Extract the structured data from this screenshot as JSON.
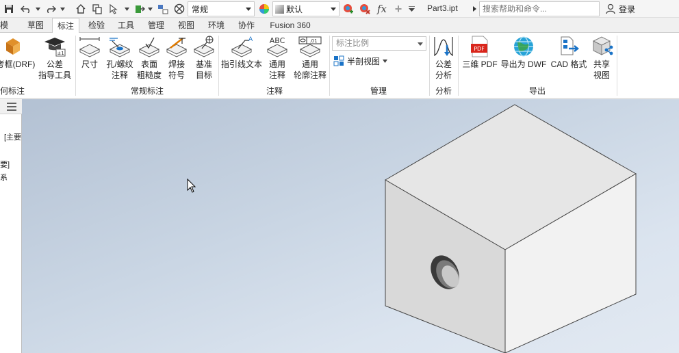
{
  "qat": {
    "style_select": "常规",
    "appearance_select": "默认",
    "fx_label": "fx",
    "document_title": "Part3.ipt",
    "search_placeholder": "搜索帮助和命令...",
    "login_label": "登录"
  },
  "tabs": [
    {
      "label": "模型"
    },
    {
      "label": "草图"
    },
    {
      "label": "标注"
    },
    {
      "label": "检验"
    },
    {
      "label": "工具"
    },
    {
      "label": "管理"
    },
    {
      "label": "视图"
    },
    {
      "label": "环境"
    },
    {
      "label": "协作"
    },
    {
      "label": "Fusion 360"
    }
  ],
  "active_tab": "标注",
  "ribbon": {
    "geometric": {
      "button": "考框(DRF)",
      "panel": "何标注"
    },
    "tolerance_advisor": {
      "line1": "公差",
      "line2": "指导工具"
    },
    "general": {
      "panel": "常规标注",
      "dimension": "尺寸",
      "hole": {
        "line1": "孔/螺纹",
        "line2": "注释"
      },
      "surface": {
        "line1": "表面",
        "line2": "粗糙度"
      },
      "weld": {
        "line1": "焊接",
        "line2": "符号"
      },
      "datum": {
        "line1": "基准",
        "line2": "目标"
      }
    },
    "notes": {
      "panel": "注释",
      "leader_text": "指引线文本",
      "general_note": {
        "line1": "通用",
        "line2": "注释"
      },
      "profile_note": {
        "line1": "通用",
        "line2": "轮廓注释"
      },
      "abc_label": "ABC"
    },
    "manage": {
      "panel": "管理",
      "scale_select": "标注比例",
      "half_section": "半剖视图"
    },
    "analysis": {
      "panel": "分析",
      "tolerance_analysis": {
        "line1": "公差",
        "line2": "分析"
      }
    },
    "export": {
      "panel": "导出",
      "pdf3d": "三维 PDF",
      "dwf": "导出为 DWF",
      "cad": "CAD 格式",
      "share": {
        "line1": "共享",
        "line2": "视图"
      },
      "pdf_icon_text": "PDF"
    }
  },
  "browser": {
    "line1": "[主要",
    "line2": "要]",
    "line3": "系"
  },
  "colors": {
    "accent": "#1a73c7",
    "tab_active_bg": "#ffffff",
    "viewport_top": "#b3c1d3",
    "viewport_bottom": "#e2e9f2",
    "cube_top": "#e6e6e6",
    "cube_left": "#d9d9d9",
    "cube_right": "#f2f2f2"
  }
}
